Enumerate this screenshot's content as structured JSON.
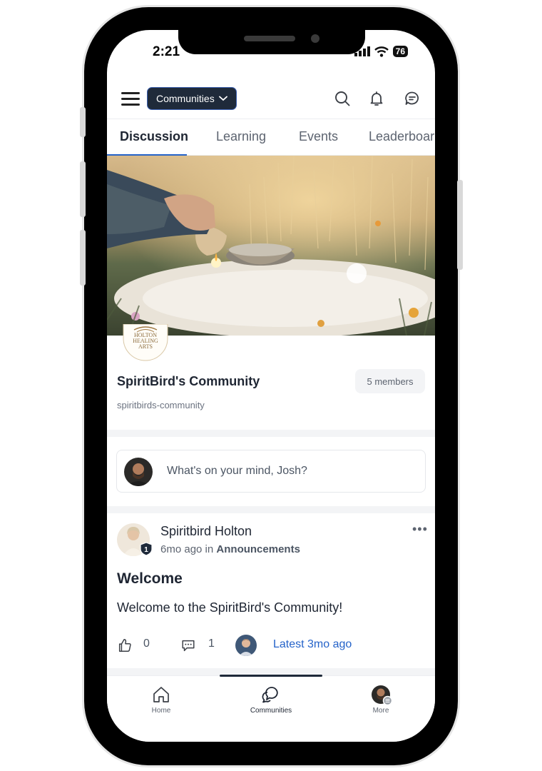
{
  "status_bar": {
    "time": "2:21",
    "battery": "76"
  },
  "header": {
    "community_switcher_label": "Communities",
    "icons": [
      "menu-icon",
      "search-icon",
      "bell-icon",
      "chat-icon"
    ]
  },
  "tabs": [
    {
      "label": "Discussion",
      "active": true
    },
    {
      "label": "Learning",
      "active": false
    },
    {
      "label": "Events",
      "active": false
    },
    {
      "label": "Leaderboar",
      "active": false
    }
  ],
  "community": {
    "logo_text": "HOLTON HEALING ARTS",
    "name": "SpiritBird's Community",
    "members": "5 members",
    "slug": "spiritbirds-community"
  },
  "composer": {
    "placeholder": "What's on your mind, Josh?"
  },
  "post": {
    "author": "Spiritbird Holton",
    "level": "1",
    "time": "6mo ago",
    "in_label": "in",
    "category": "Announcements",
    "title": "Welcome",
    "body": "Welcome to the SpiritBird's Community!",
    "likes": "0",
    "comments": "1",
    "latest": "Latest 3mo ago"
  },
  "bottom_nav": [
    {
      "label": "Home",
      "icon": "home-icon",
      "active": false
    },
    {
      "label": "Communities",
      "icon": "communities-icon",
      "active": true
    },
    {
      "label": "More",
      "icon": "profile-avatar",
      "active": false
    }
  ],
  "colors": {
    "accent": "#2563c9",
    "pill_bg": "#1f2a3a",
    "text": "#1f2633"
  }
}
